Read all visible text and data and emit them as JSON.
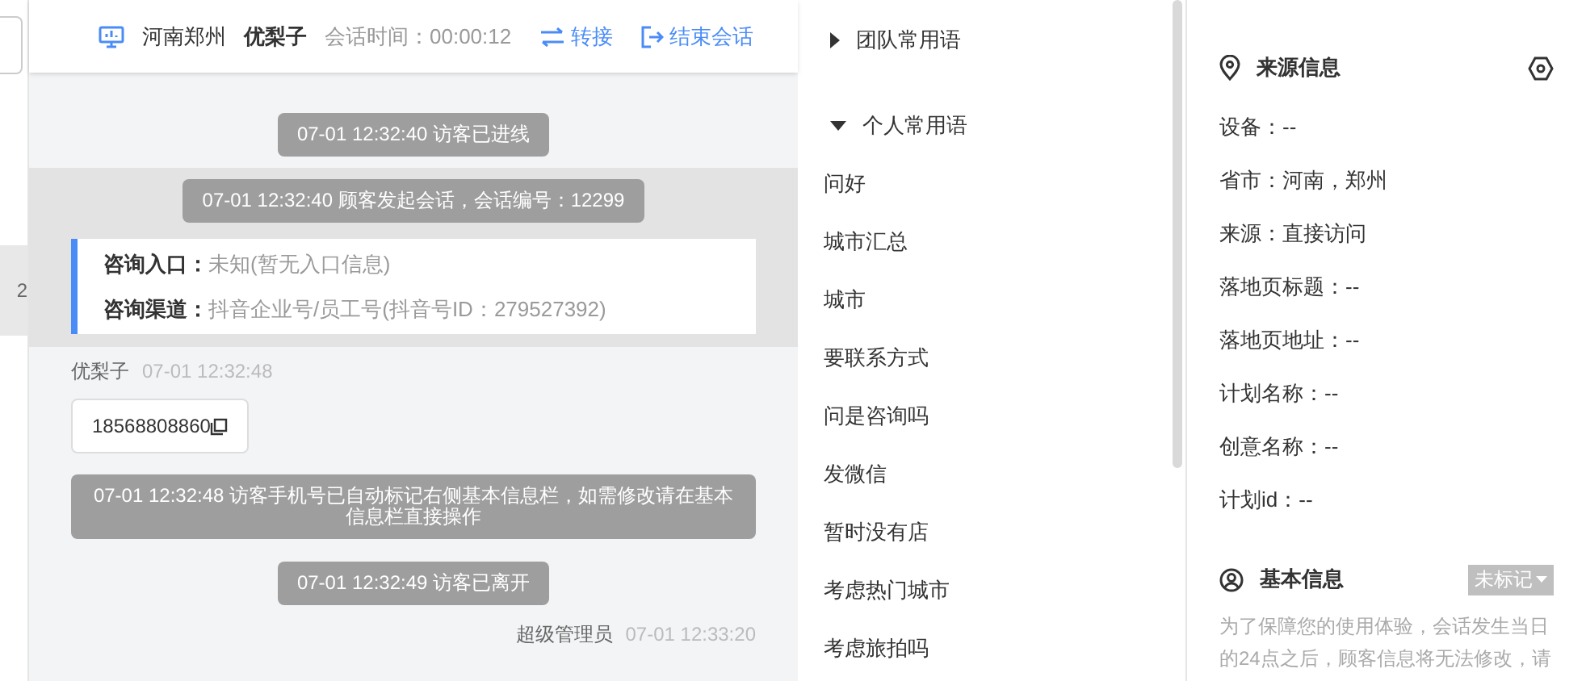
{
  "left_strip": {
    "badge": "2"
  },
  "chat_header": {
    "location": "河南郑州",
    "visitor": "优梨子",
    "duration": "会话时间：00:00:12",
    "actions": [
      {
        "kind": "transfer",
        "label": "转接"
      },
      {
        "kind": "end",
        "label": "结束会话"
      }
    ]
  },
  "messages": [
    {
      "kind": "system",
      "text": "07-01 12:32:40 访客已进线",
      "highlighted": false
    },
    {
      "kind": "system",
      "text": "07-01 12:32:40 顾客发起会话，会话编号：12299",
      "highlighted": true
    },
    {
      "kind": "info_card",
      "highlighted": true,
      "lines": [
        {
          "label": "咨询入口：",
          "value": "未知(暂无入口信息)"
        },
        {
          "label": "咨询渠道：",
          "value": "抖音企业号/员工号(抖音号ID：279527392)"
        }
      ]
    },
    {
      "kind": "visitor",
      "sender": "优梨子",
      "time": "07-01 12:32:48",
      "text": "18568808860"
    },
    {
      "kind": "system",
      "text": "07-01 12:32:48 访客手机号已自动标记右侧基本信息栏，如需修改请在基本信息栏直接操作",
      "highlighted": false
    },
    {
      "kind": "system",
      "text": "07-01 12:32:49 访客已离开",
      "highlighted": false
    },
    {
      "kind": "agent",
      "sender": "超级管理员",
      "time": "07-01 12:33:20"
    }
  ],
  "phrases": {
    "groups": [
      {
        "title": "团队常用语",
        "expanded": false
      },
      {
        "title": "个人常用语",
        "expanded": true,
        "items": [
          "问好",
          "城市汇总",
          "城市",
          "要联系方式",
          "问是咨询吗",
          "发微信",
          "暂时没有店",
          "考虑热门城市",
          "考虑旅拍吗"
        ]
      }
    ]
  },
  "source_info": {
    "title": "来源信息",
    "rows": [
      "设备：--",
      "省市：河南，郑州",
      "来源：直接访问",
      "落地页标题：--",
      "落地页地址：--",
      "计划名称：--",
      "创意名称：--",
      "计划id：--"
    ]
  },
  "basic_info": {
    "title": "基本信息",
    "tag": "未标记",
    "notice": "为了保障您的使用体验，会话发生当日的24点之后，顾客信息将无法修改，请"
  }
}
